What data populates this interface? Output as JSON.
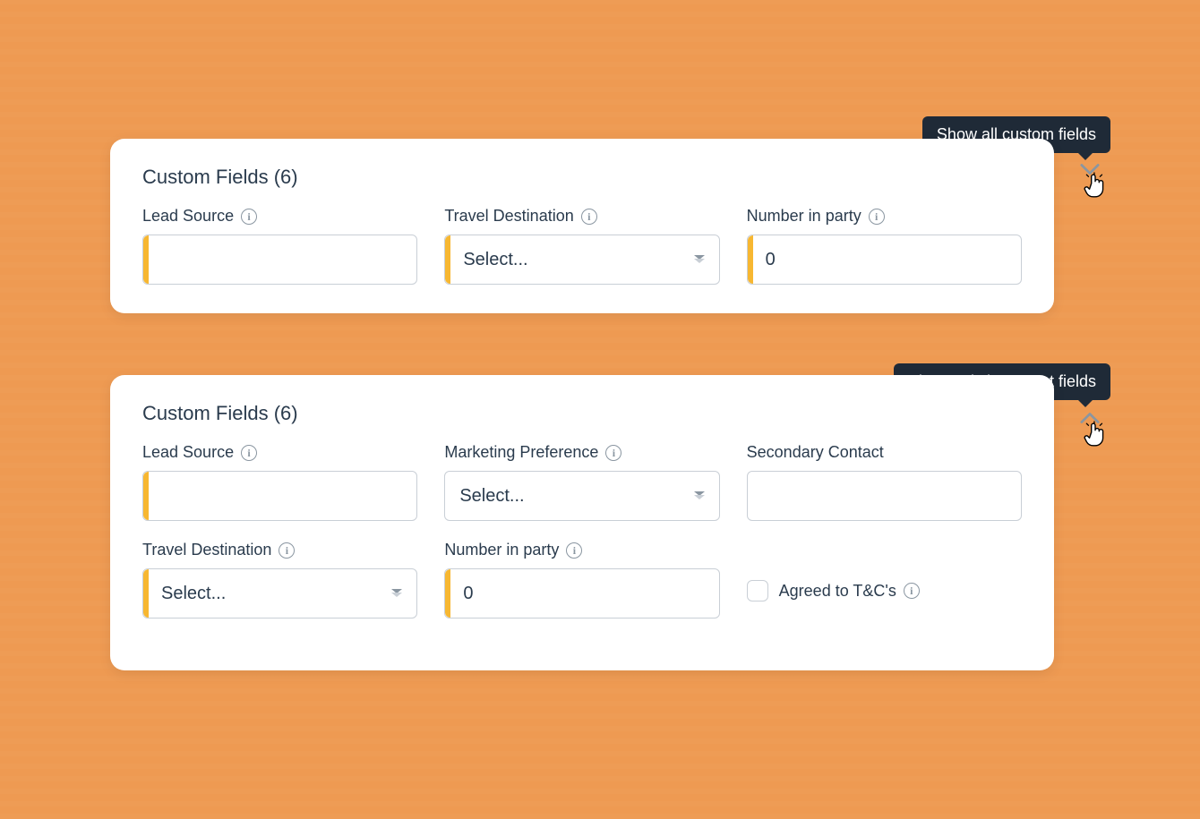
{
  "tooltips": {
    "showAll": "Show all custom fields",
    "showImportant": "Show only important fields"
  },
  "card1": {
    "title": "Custom Fields (6)",
    "fields": {
      "leadSource": {
        "label": "Lead Source",
        "value": ""
      },
      "travelDestination": {
        "label": "Travel Destination",
        "placeholder": "Select..."
      },
      "numberInParty": {
        "label": "Number in party",
        "value": "0"
      }
    }
  },
  "card2": {
    "title": "Custom Fields (6)",
    "fields": {
      "leadSource": {
        "label": "Lead Source",
        "value": ""
      },
      "marketingPreference": {
        "label": "Marketing Preference",
        "placeholder": "Select..."
      },
      "secondaryContact": {
        "label": "Secondary Contact",
        "value": ""
      },
      "travelDestination": {
        "label": "Travel Destination",
        "placeholder": "Select..."
      },
      "numberInParty": {
        "label": "Number in party",
        "value": "0"
      },
      "agreed": {
        "label": "Agreed to T&C's",
        "checked": false
      }
    }
  }
}
